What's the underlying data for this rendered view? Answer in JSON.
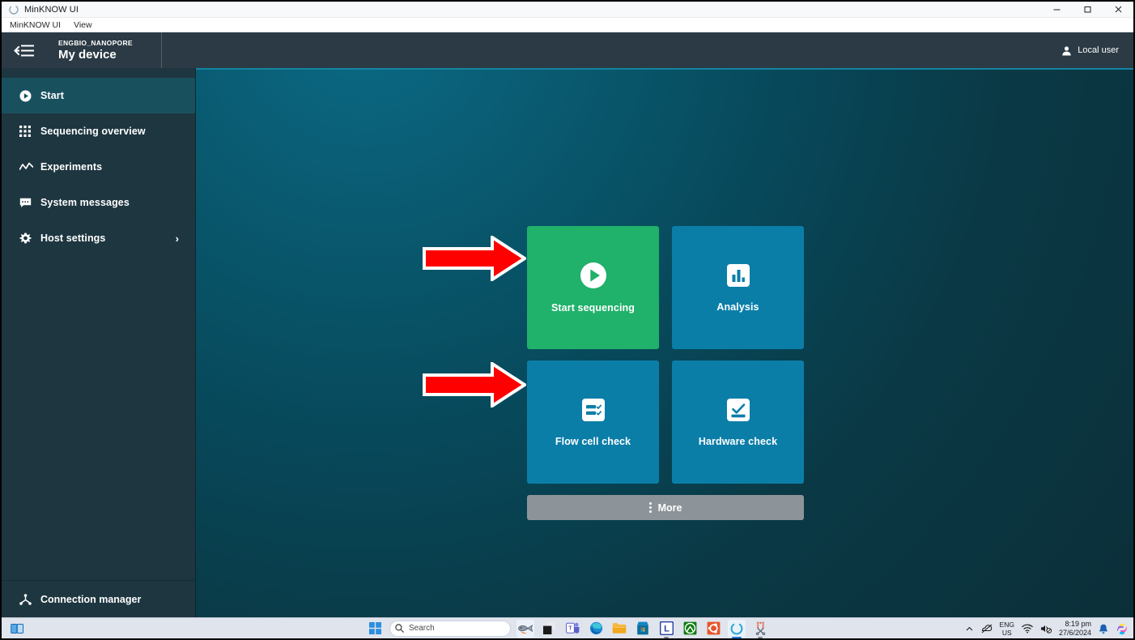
{
  "window": {
    "title": "MinKNOW UI",
    "app_icon": "minknow-circle-icon",
    "controls": {
      "minimize": "—",
      "maximize": "❐",
      "close": "×"
    }
  },
  "menubar": {
    "items": [
      {
        "label": "MinKNOW UI",
        "name": "menu-minknow-ui"
      },
      {
        "label": "View",
        "name": "menu-view"
      }
    ]
  },
  "header": {
    "menu_toggle_icon": "collapse-menu-icon",
    "organisation": "ENGBIO_NANOPORE",
    "device_name": "My device",
    "user": {
      "icon": "person-icon",
      "label": "Local user"
    }
  },
  "sidebar": {
    "items": [
      {
        "label": "Start",
        "icon": "play-circle-icon",
        "name": "sidebar-item-start",
        "active": true,
        "chevron": ""
      },
      {
        "label": "Sequencing overview",
        "icon": "grid-dots-icon",
        "name": "sidebar-item-sequencing-overview",
        "active": false,
        "chevron": ""
      },
      {
        "label": "Experiments",
        "icon": "line-chart-icon",
        "name": "sidebar-item-experiments",
        "active": false,
        "chevron": ""
      },
      {
        "label": "System messages",
        "icon": "message-icon",
        "name": "sidebar-item-system-messages",
        "active": false,
        "chevron": ""
      },
      {
        "label": "Host settings",
        "icon": "gear-icon",
        "name": "sidebar-item-host-settings",
        "active": false,
        "chevron": "›"
      }
    ],
    "footer": {
      "label": "Connection manager",
      "icon": "connection-node-icon"
    }
  },
  "main": {
    "tiles": [
      {
        "label": "Start sequencing",
        "icon": "play-circle-icon",
        "color": "#20b16a",
        "style": "green"
      },
      {
        "label": "Analysis",
        "icon": "bar-chart-icon",
        "color": "#0b7ea8",
        "style": "blue"
      },
      {
        "label": "Flow cell check",
        "icon": "checklist-icon",
        "color": "#0b7ea8",
        "style": "blue"
      },
      {
        "label": "Hardware check",
        "icon": "check-card-icon",
        "color": "#0b7ea8",
        "style": "blue"
      }
    ],
    "more_button": {
      "label": "More",
      "icon": "vertical-dots-icon",
      "color": "#8d9499"
    },
    "annotations": [
      {
        "name": "red-arrow-start-sequencing",
        "points_to": "Start sequencing",
        "color": "#fe0000",
        "outline": "#ffffff"
      },
      {
        "name": "red-arrow-flow-cell-check",
        "points_to": "Flow cell check",
        "color": "#fe0000",
        "outline": "#ffffff"
      }
    ]
  },
  "taskbar": {
    "task_view": {
      "icon": "task-view-icon"
    },
    "start": {
      "icon": "windows-start-icon"
    },
    "search": {
      "icon": "search-icon",
      "placeholder": "Search",
      "value": ""
    },
    "pinned": [
      {
        "name": "taskbar-icon-fish",
        "icon": "fish-icon",
        "running": false
      },
      {
        "name": "taskbar-icon-file-explorer-dark",
        "icon": "dark-squares-icon",
        "running": false
      },
      {
        "name": "taskbar-icon-teams",
        "icon": "teams-icon",
        "running": false
      },
      {
        "name": "taskbar-icon-edge",
        "icon": "edge-icon",
        "running": false
      },
      {
        "name": "taskbar-icon-file-explorer",
        "icon": "folder-icon",
        "running": false
      },
      {
        "name": "taskbar-icon-microsoft-store",
        "icon": "store-bag-icon",
        "running": false
      },
      {
        "name": "taskbar-icon-l-app",
        "icon": "letter-l-icon",
        "running": true
      },
      {
        "name": "taskbar-icon-xbox",
        "icon": "xbox-icon",
        "running": false
      },
      {
        "name": "taskbar-icon-ubuntu",
        "icon": "ubuntu-icon",
        "running": false
      },
      {
        "name": "taskbar-icon-minknow",
        "icon": "minknow-circle-icon",
        "running": true
      },
      {
        "name": "taskbar-icon-snipping-tool",
        "icon": "scissors-icon",
        "running": true
      }
    ],
    "tray": {
      "overflow_icon": "chevron-up-icon",
      "network_icon": "no-internet-icon",
      "language_top": "ENG",
      "language_bottom": "US",
      "wifi_icon": "wifi-icon",
      "volume_icon": "volume-muted-icon",
      "time": "8:19 pm",
      "date": "27/6/2024",
      "notification_icon": "bell-icon",
      "copilot_icon": "copilot-icon"
    }
  },
  "colors": {
    "header_bg": "#2b3a44",
    "sidebar_bg": "#1e3640",
    "sidebar_active": "#19505e",
    "main_bg_light": "#0b6a85",
    "main_bg_dark": "#0b2f39",
    "tile_green": "#20b16a",
    "tile_blue": "#0b7ea8",
    "more_grey": "#8d9499",
    "arrow_red": "#fe0000"
  }
}
